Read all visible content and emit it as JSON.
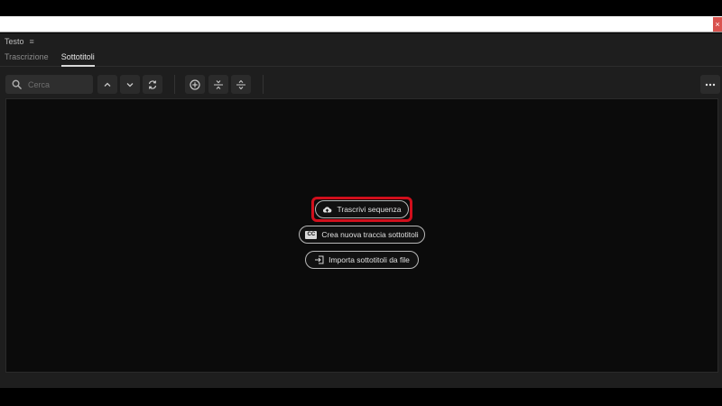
{
  "panel": {
    "title": "Testo",
    "menu_icon": "hamburger-icon"
  },
  "tabs": [
    {
      "label": "Trascrizione",
      "active": false
    },
    {
      "label": "Sottotitoli",
      "active": true
    }
  ],
  "toolbar": {
    "search_placeholder": "Cerca",
    "buttons": [
      "chevron-up-icon",
      "chevron-down-icon",
      "refresh-icon",
      "add-icon",
      "merge-icon",
      "split-icon",
      "more-icon"
    ]
  },
  "actions": {
    "transcribe_label": "Trascrivi sequenza",
    "new_track_label": "Crea nuova traccia sottotitoli",
    "import_label": "Importa sottotitoli da file",
    "cc_badge": "CC"
  },
  "colors": {
    "highlight": "#d10f1c",
    "panel_bg": "#1e1e1e",
    "content_bg": "#0b0b0b"
  }
}
